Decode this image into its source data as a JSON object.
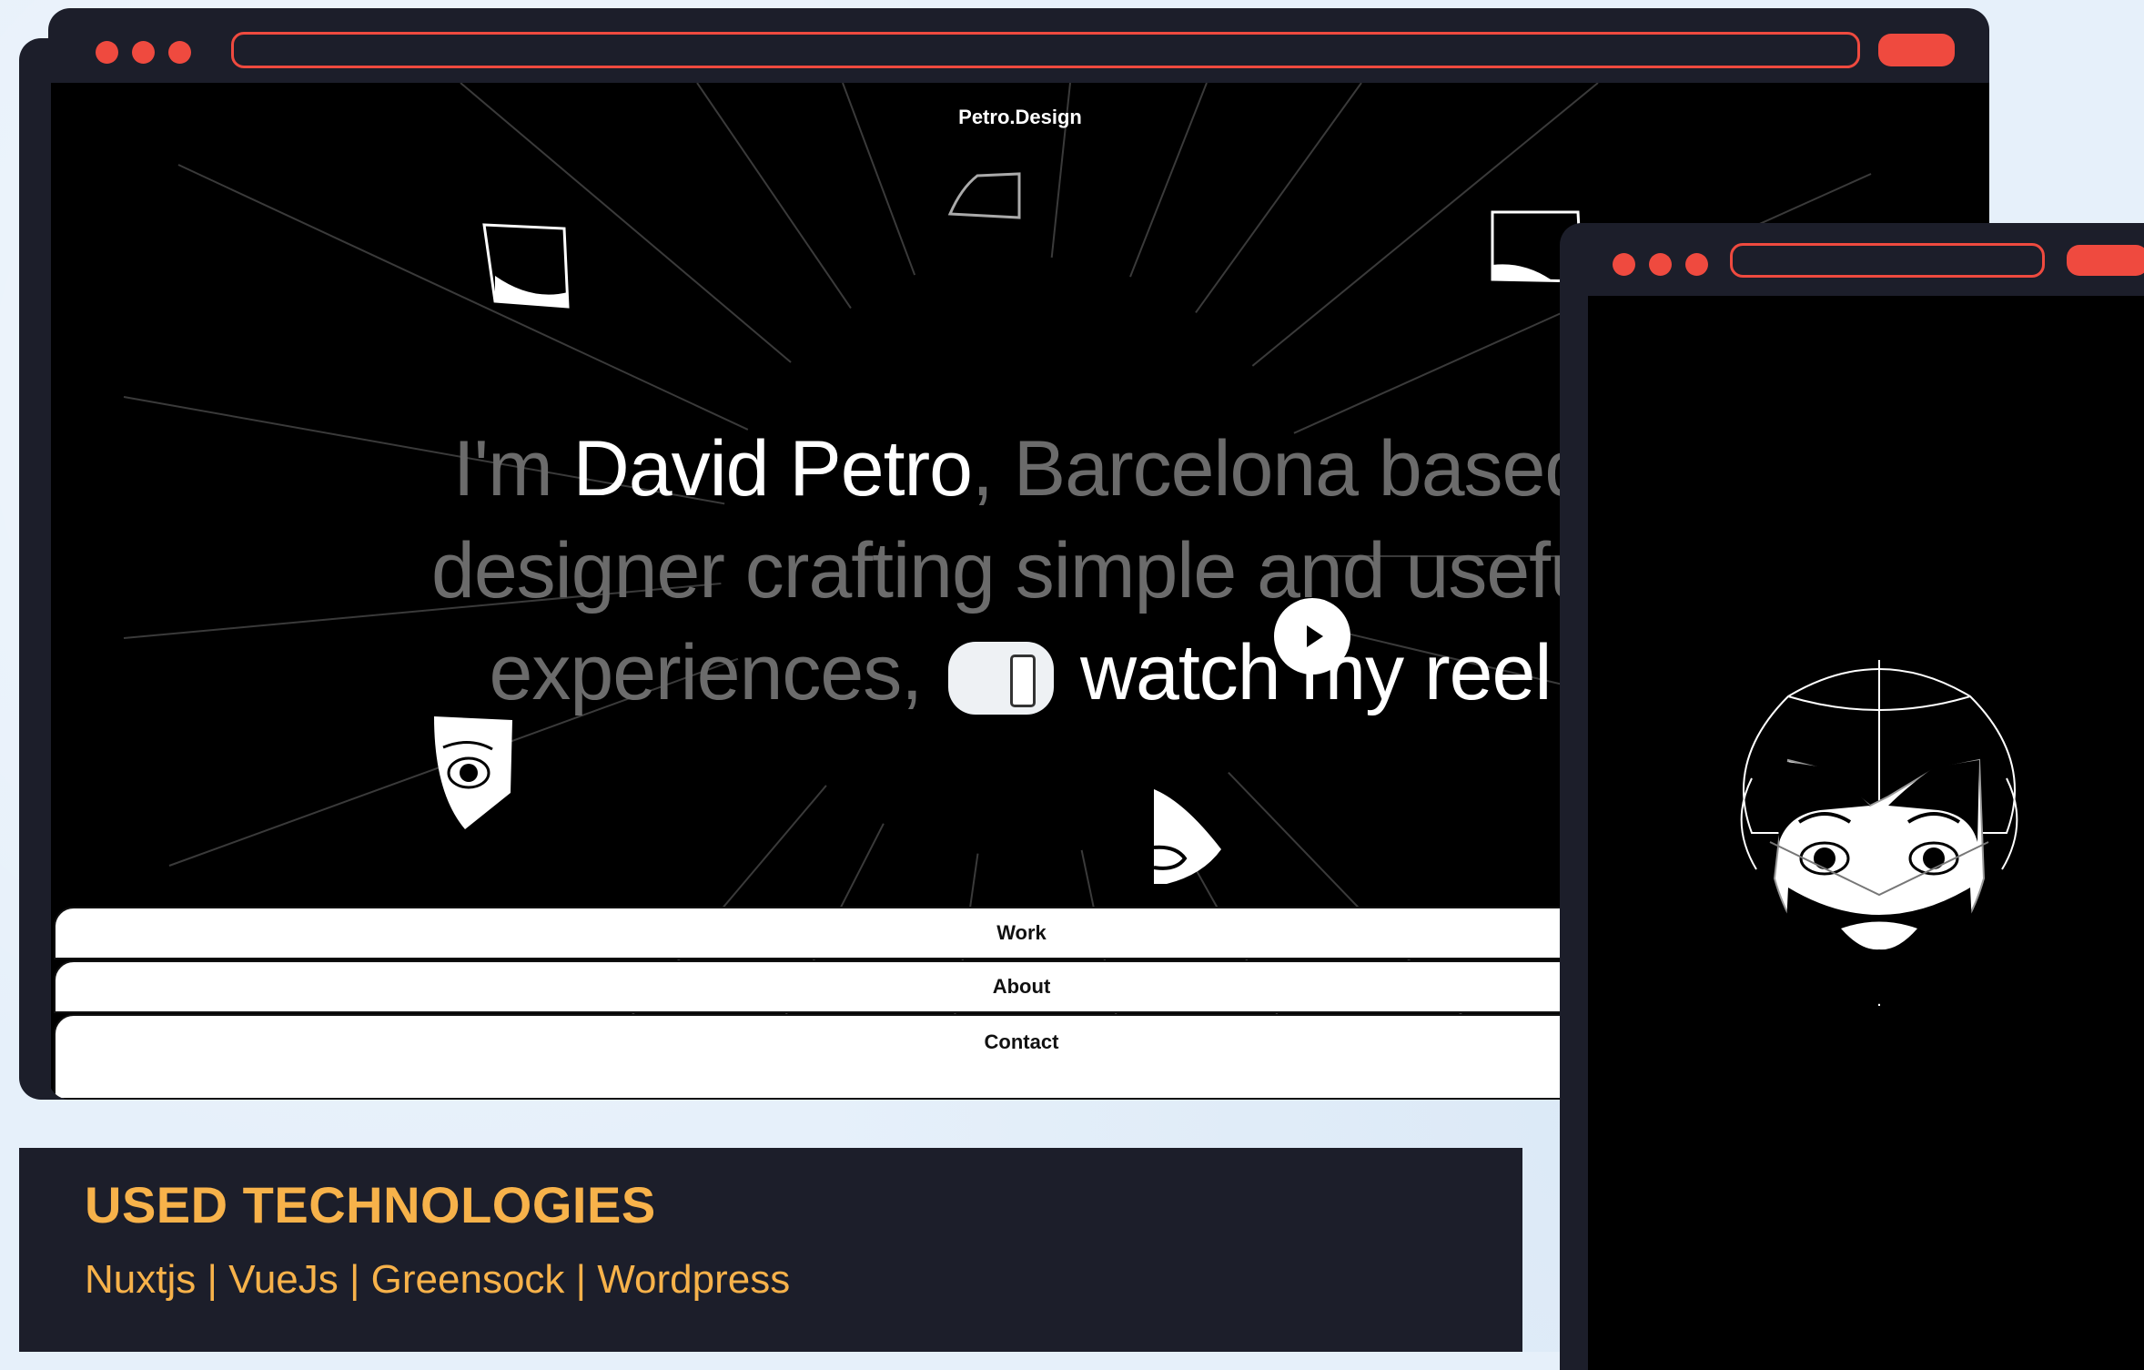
{
  "site": {
    "title": "Petro.Design"
  },
  "hero": {
    "line1_pre": "I'm ",
    "line1_name": "David Petro",
    "line1_post": ", Barcelona based",
    "line2": "designer crafting simple and useful",
    "line3_pre": "experiences, ",
    "line3_cta": "watch my reel"
  },
  "nav": {
    "work": "Work",
    "about": "About",
    "contact": "Contact"
  },
  "technologies": {
    "title": "USED TECHNOLOGIES",
    "list": "Nuxtjs | VueJs | Greensock | Wordpress"
  },
  "colors": {
    "background": "#e6f0fa",
    "frame": "#1c1e2a",
    "accent_red": "#ef4a3f",
    "accent_orange": "#f7b24a"
  },
  "icons": {
    "window_controls": "traffic-light-dots",
    "reel": "phone-thumbnail",
    "play": "play-icon",
    "avatar": "bearded-face-illustration"
  }
}
